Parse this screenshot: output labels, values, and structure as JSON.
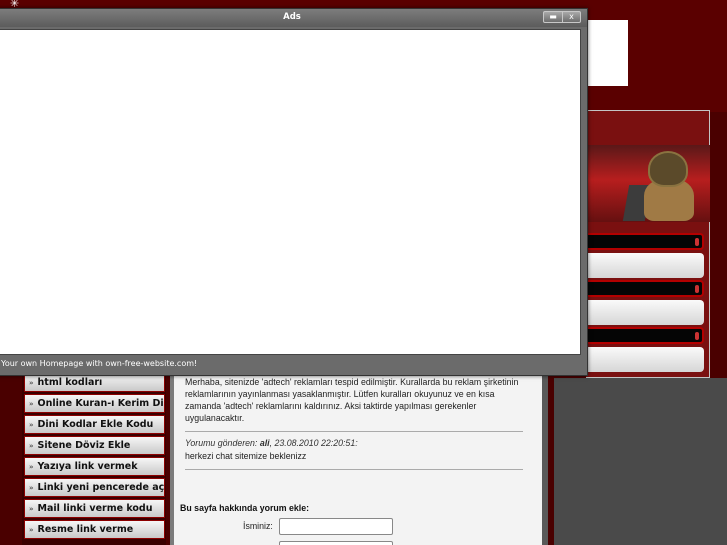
{
  "popup": {
    "title": "Ads",
    "minimize_symbol": "▬",
    "close_symbol": "x",
    "footer_text": "Your own Homepage with own-free-website.com!"
  },
  "sidebar": {
    "items": [
      {
        "label": "html kodları"
      },
      {
        "label": "Online Kuran-ı Kerim Dinle"
      },
      {
        "label": "Dini Kodlar Ekle Kodu"
      },
      {
        "label": "Sitene Döviz Ekle"
      },
      {
        "label": "Yazıya link vermek"
      },
      {
        "label": "Linki yeni pencerede açmak"
      },
      {
        "label": "Mail linki verme kodu"
      },
      {
        "label": "Resme link verme"
      }
    ]
  },
  "content": {
    "notice_text": "Merhaba, sitenizde 'adtech' reklamları tespid edilmiştir. Kurallarda bu reklam şirketinin reklamlarının yayınlanması yasaklanmıştır. Lütfen kuralları okuyunuz ve en kısa zamanda 'adtech' reklamlarını kaldırınız. Aksi taktirde yapılması gerekenler uygulanacaktır.",
    "comment_prefix": "Yorumu gönderen: ",
    "comment_author": "ali",
    "comment_date": ", 23.08.2010 22:20:51:",
    "comment_text": "herkezi chat sitemize beklenizz",
    "form_title": "Bu sayfa hakkında yorum ekle:",
    "name_label": "İsminiz:"
  },
  "colors": {
    "background": "#4a0000",
    "menu_border": "#8c0000",
    "accent_red": "#b40000"
  }
}
